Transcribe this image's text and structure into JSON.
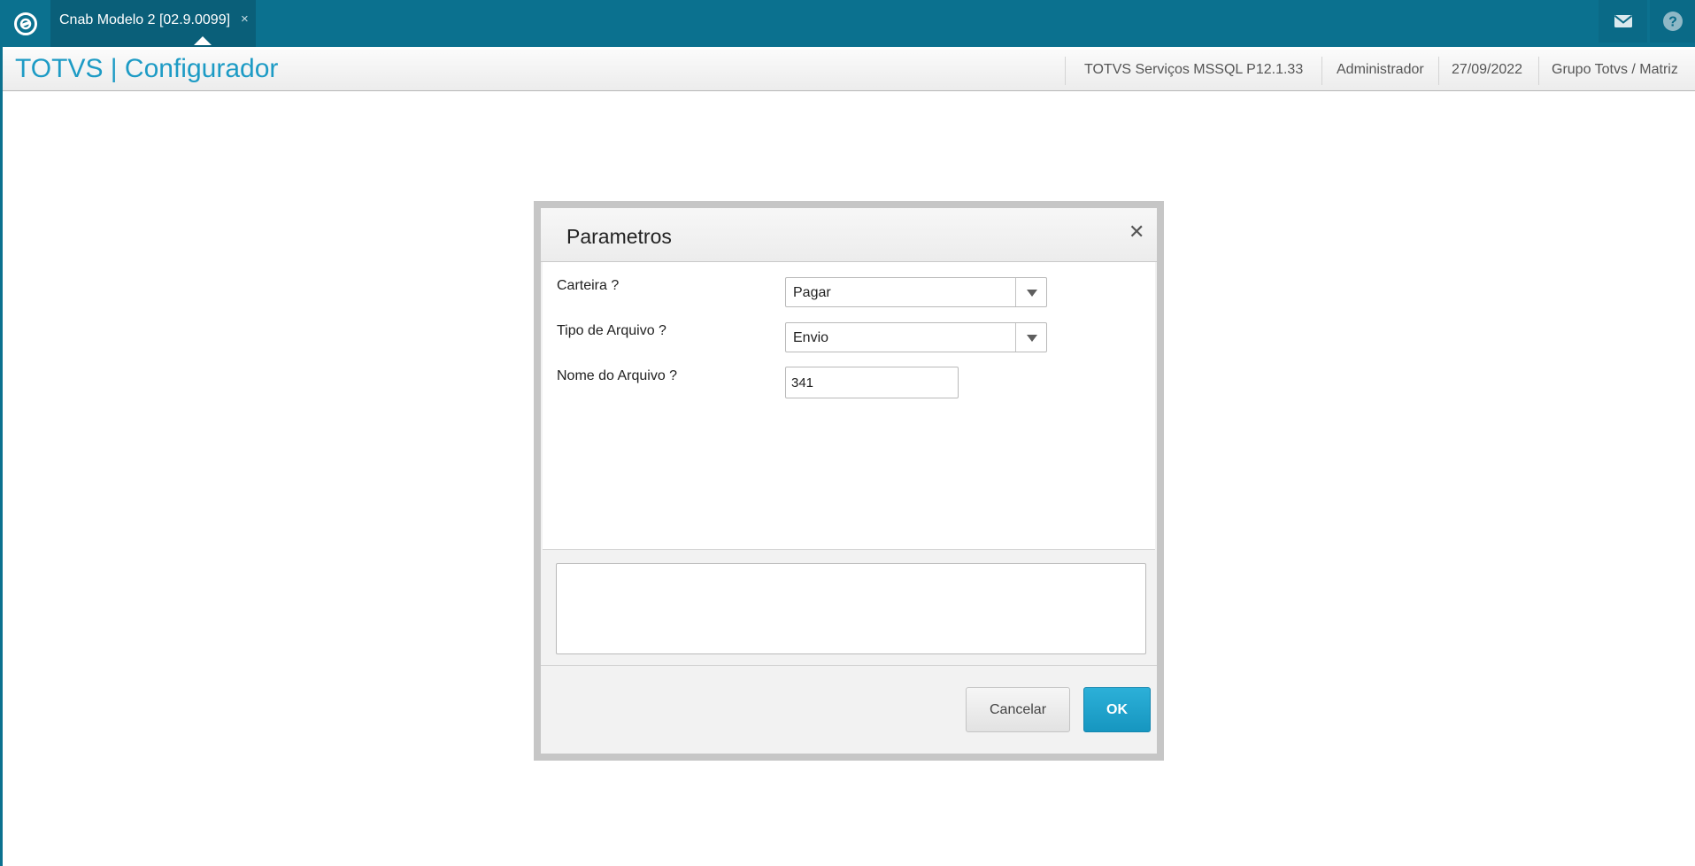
{
  "topbar": {
    "logo_icon": "totvs-logo-icon",
    "tab": {
      "label": "Cnab Modelo 2 [02.9.0099]",
      "close_glyph": "×"
    },
    "right_icons": [
      "mail-icon",
      "help-icon"
    ]
  },
  "header": {
    "app_title": "TOTVS | Configurador",
    "environment": "TOTVS Serviços MSSQL P12.1.33",
    "user": "Administrador",
    "date": "27/09/2022",
    "company": "Grupo Totvs / Matriz"
  },
  "dialog": {
    "title": "Parametros",
    "close_glyph": "✕",
    "fields": [
      {
        "label": "Carteira ?",
        "type": "combo",
        "value": "Pagar"
      },
      {
        "label": "Tipo de Arquivo ?",
        "type": "combo",
        "value": "Envio"
      },
      {
        "label": "Nome do Arquivo ?",
        "type": "text",
        "value": "341"
      }
    ],
    "help_text": "",
    "buttons": {
      "cancel": "Cancelar",
      "ok": "OK"
    }
  },
  "colors": {
    "topbar": "#0b718f",
    "accent": "#1d9bc5",
    "ok_button": "#1ea3cc"
  }
}
